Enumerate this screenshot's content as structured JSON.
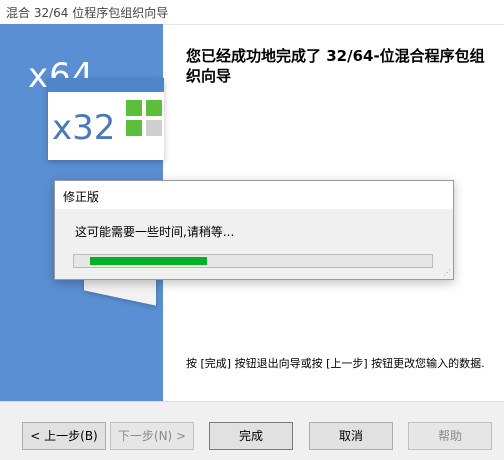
{
  "window": {
    "title": "混合 32/64 位程序包组织向导"
  },
  "graphic": {
    "x64_label": "x64",
    "x32_label": "x32"
  },
  "main": {
    "heading": "您已经成功地完成了 32/64-位混合程序包组织向导",
    "info": "按 [完成] 按钮退出向导或按 [上一步] 按钮更改您输入的数据."
  },
  "buttons": {
    "back": "< 上一步(B)",
    "next": "下一步(N) >",
    "finish": "完成",
    "cancel": "取消",
    "help": "帮助"
  },
  "dialog": {
    "title": "修正版",
    "message": "这可能需要一些时间,请稍等...",
    "progress_fraction": 0.36
  },
  "colors": {
    "side_panel": "#5b8fd3",
    "progress_fill": "#06b025",
    "logo_green": "#5bbf3c",
    "logo_gray": "#cfcfcf"
  }
}
